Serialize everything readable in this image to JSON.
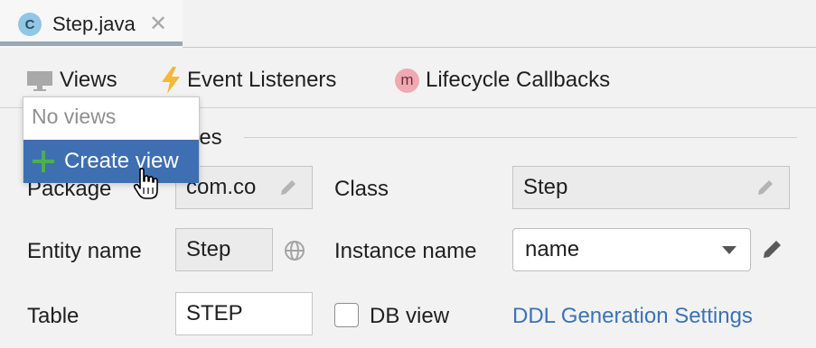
{
  "tab": {
    "icon_letter": "C",
    "title": "Step.java",
    "close_glyph": "✕",
    "icon_color": "#8fc7e5"
  },
  "toolbar": {
    "views_label": "Views",
    "event_listeners_label": "Event Listeners",
    "lifecycle_icon_letter": "m",
    "lifecycle_label": "Lifecycle Callbacks",
    "event_icon_color": "#f4b73a"
  },
  "section": {
    "label_suffix": "ies"
  },
  "form": {
    "package_label": "Package",
    "package_value": "com.co",
    "class_label": "Class",
    "class_value": "Step",
    "entity_name_label": "Entity name",
    "entity_name_value": "Step",
    "instance_name_label": "Instance name",
    "instance_name_value": "name",
    "table_label": "Table",
    "table_value": "STEP",
    "db_view_label": "DB view",
    "db_view_checked": false,
    "ddl_link": "DDL Generation Settings",
    "link_color": "#3a73b5"
  },
  "popup": {
    "empty_text": "No views",
    "create_label": "Create view",
    "highlight_color": "#3e6fb2",
    "plus_color": "#4caf50"
  }
}
